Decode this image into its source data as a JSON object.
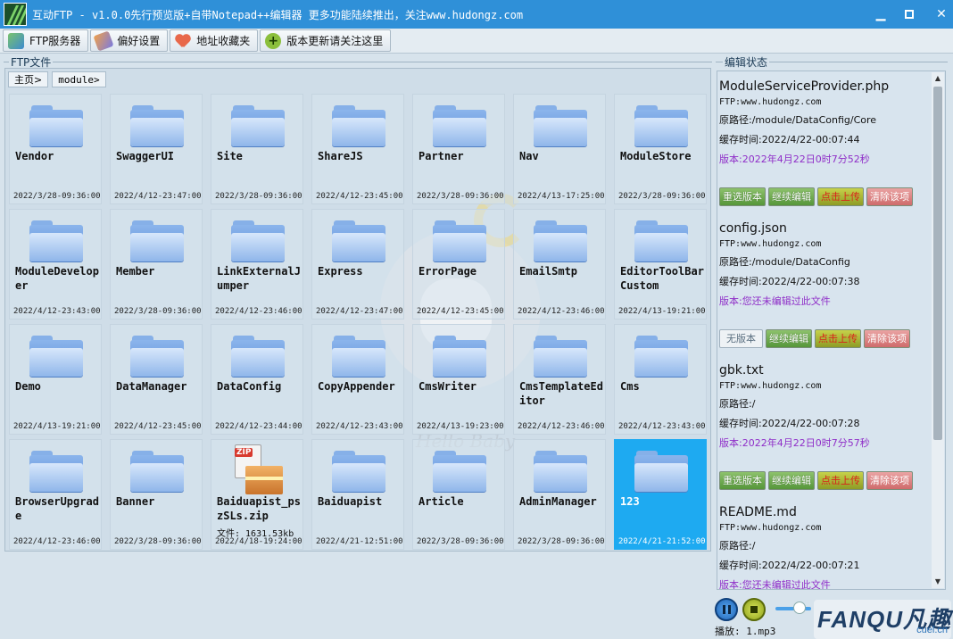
{
  "window": {
    "app_name": "互动FTP",
    "subtitle": " - v1.0.0先行预览版+自带Notepad++编辑器  更多功能陆续推出，关注www.hudongz.com",
    "minimize_label": "▁",
    "close_label": "✕"
  },
  "toolbar": [
    {
      "label": "FTP服务器",
      "icon": "ftp-server-icon"
    },
    {
      "label": "偏好设置",
      "icon": "preferences-icon"
    },
    {
      "label": "地址收藏夹",
      "icon": "favorites-heart-icon"
    },
    {
      "label": "版本更新请关注这里",
      "icon": "update-plus-icon"
    }
  ],
  "left_section": {
    "title": "FTP文件",
    "breadcrumb": [
      "主页>",
      "module>"
    ]
  },
  "right_section": {
    "title": "编辑状态"
  },
  "files": [
    {
      "name": "Vendor",
      "date": "2022/3/28-09:36:00",
      "type": "folder"
    },
    {
      "name": "SwaggerUI",
      "date": "2022/4/12-23:47:00",
      "type": "folder"
    },
    {
      "name": "Site",
      "date": "2022/3/28-09:36:00",
      "type": "folder"
    },
    {
      "name": "ShareJS",
      "date": "2022/4/12-23:45:00",
      "type": "folder"
    },
    {
      "name": "Partner",
      "date": "2022/3/28-09:36:00",
      "type": "folder"
    },
    {
      "name": "Nav",
      "date": "2022/4/13-17:25:00",
      "type": "folder"
    },
    {
      "name": "ModuleStore",
      "date": "2022/3/28-09:36:00",
      "type": "folder"
    },
    {
      "name": "ModuleDeveloper",
      "date": "2022/4/12-23:43:00",
      "type": "folder"
    },
    {
      "name": "Member",
      "date": "2022/3/28-09:36:00",
      "type": "folder"
    },
    {
      "name": "LinkExternalJumper",
      "date": "2022/4/12-23:46:00",
      "type": "folder"
    },
    {
      "name": "Express",
      "date": "2022/4/12-23:47:00",
      "type": "folder"
    },
    {
      "name": "ErrorPage",
      "date": "2022/4/12-23:45:00",
      "type": "folder"
    },
    {
      "name": "EmailSmtp",
      "date": "2022/4/12-23:46:00",
      "type": "folder"
    },
    {
      "name": "EditorToolBarCustom",
      "date": "2022/4/13-19:21:00",
      "type": "folder"
    },
    {
      "name": "Demo",
      "date": "2022/4/13-19:21:00",
      "type": "folder"
    },
    {
      "name": "DataManager",
      "date": "2022/4/12-23:45:00",
      "type": "folder"
    },
    {
      "name": "DataConfig",
      "date": "2022/4/12-23:44:00",
      "type": "folder"
    },
    {
      "name": "CopyAppender",
      "date": "2022/4/12-23:43:00",
      "type": "folder"
    },
    {
      "name": "CmsWriter",
      "date": "2022/4/13-19:23:00",
      "type": "folder"
    },
    {
      "name": "CmsTemplateEditor",
      "date": "2022/4/12-23:46:00",
      "type": "folder"
    },
    {
      "name": "Cms",
      "date": "2022/4/12-23:43:00",
      "type": "folder"
    },
    {
      "name": "BrowserUpgrade",
      "date": "2022/4/12-23:46:00",
      "type": "folder"
    },
    {
      "name": "Banner",
      "date": "2022/3/28-09:36:00",
      "type": "folder"
    },
    {
      "name": "Baiduapist_pszSLs.zip",
      "date": "2022/4/18-19:24:00",
      "type": "zip",
      "size": "文件: 1631.53kb",
      "zip_badge": "ZIP"
    },
    {
      "name": "Baiduapist",
      "date": "2022/4/21-12:51:00",
      "type": "folder"
    },
    {
      "name": "Article",
      "date": "2022/3/28-09:36:00",
      "type": "folder"
    },
    {
      "name": "AdminManager",
      "date": "2022/3/28-09:36:00",
      "type": "folder"
    },
    {
      "name": "123",
      "date": "2022/4/21-21:52:00",
      "type": "folder",
      "selected": true
    }
  ],
  "edit_entries": [
    {
      "file": "ModuleServiceProvider.php",
      "host": "FTP:www.hudongz.com",
      "path": "原路径:/module/DataConfig/Core",
      "cache": "缓存时间:2022/4/22-00:07:44",
      "version": "版本:2022年4月22日0时7分52秒",
      "buttons": [
        "重选版本",
        "继续编辑",
        "点击上传",
        "清除该项"
      ]
    },
    {
      "file": "config.json",
      "host": "FTP:www.hudongz.com",
      "path": "原路径:/module/DataConfig",
      "cache": "缓存时间:2022/4/22-00:07:38",
      "version": "版本:您还未编辑过此文件",
      "buttons": [
        "无版本",
        "继续编辑",
        "点击上传",
        "清除该项"
      ]
    },
    {
      "file": "gbk.txt",
      "host": "FTP:www.hudongz.com",
      "path": "原路径:/",
      "cache": "缓存时间:2022/4/22-00:07:28",
      "version": "版本:2022年4月22日0时7分57秒",
      "buttons": [
        "重选版本",
        "继续编辑",
        "点击上传",
        "清除该项"
      ]
    },
    {
      "file": "README.md",
      "host": "FTP:www.hudongz.com",
      "path": "原路径:/",
      "cache": "缓存时间:2022/4/22-00:07:21",
      "version": "版本:您还未编辑过此文件",
      "buttons": []
    }
  ],
  "player": {
    "now_playing": "播放: 1.mp3",
    "volume": 0.5
  },
  "watermark": {
    "text": "Hello Baby"
  },
  "brand": {
    "main": "FANQU凡趣",
    "sub": "cuel.cn"
  },
  "colors": {
    "titlebar": "#2f90d8",
    "selected": "#1eaaf1",
    "version_text": "#8f2ec8"
  }
}
